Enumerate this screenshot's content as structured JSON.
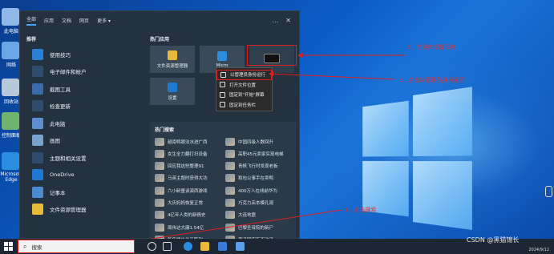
{
  "desktop": {
    "icons": [
      {
        "label": "此电脑",
        "icon": "computer-icon",
        "color": "#8fb8e8"
      },
      {
        "label": "网络",
        "icon": "network-icon",
        "color": "#6aa6e6"
      },
      {
        "label": "回收站",
        "icon": "recycle-bin-icon",
        "color": "#b6c8da"
      },
      {
        "label": "控制面板",
        "icon": "control-panel-icon",
        "color": "#6fb36f"
      },
      {
        "label": "Microsoft Edge",
        "icon": "edge-icon",
        "color": "#2a8de0"
      }
    ]
  },
  "start_menu": {
    "tabs": [
      "全部",
      "应用",
      "文档",
      "网页",
      "更多 ▾"
    ],
    "top_icons": [
      "…",
      "✕"
    ],
    "recommended_title": "推荐",
    "recommended": [
      {
        "label": "使用技巧",
        "icon": "tips-icon",
        "color": "#2a7fd6"
      },
      {
        "label": "电子邮件和帐户",
        "icon": "mail-icon",
        "color": "#2e4d6e"
      },
      {
        "label": "截图工具",
        "icon": "scissors-icon",
        "color": "#3b6aa8"
      },
      {
        "label": "检查更新",
        "icon": "refresh-icon",
        "color": "#2e4d6e"
      },
      {
        "label": "此电脑",
        "icon": "computer-icon",
        "color": "#5d8fd0"
      },
      {
        "label": "画图",
        "icon": "paint-icon",
        "color": "#7aa2cc"
      },
      {
        "label": "主题和相关设置",
        "icon": "brush-icon",
        "color": "#2e4d6e"
      },
      {
        "label": "OneDrive",
        "icon": "cloud-icon",
        "color": "#1f78d1"
      },
      {
        "label": "记事本",
        "icon": "notepad-icon",
        "color": "#4a8ad0"
      },
      {
        "label": "文件资源管理器",
        "icon": "folder-icon",
        "color": "#e8b93a"
      }
    ],
    "hot_apps_title": "热门应用",
    "hot_apps": [
      {
        "label": "文件资源管理器",
        "icon": "folder-icon",
        "color": "#e8b93a"
      },
      {
        "label": "Micro",
        "icon": "edge-icon",
        "color": "#2a8de0"
      },
      {
        "label": "",
        "icon": "terminal-icon",
        "color": "#111111"
      },
      {
        "label": "设置",
        "icon": "gear-icon",
        "color": "#1f78d1"
      }
    ],
    "hot_search_title": "热门搜索",
    "hot_search": [
      "越南鸭眼法水进广西",
      "中国四级人数回升",
      "女生全力翻打扫设备",
      "高职45元卖家实现电梯",
      "回应我这些整理91",
      "青帆飞行时发现老板",
      "马英主题时获得大功",
      "和包公事手在卖鸭",
      "六小龄童谈演西游戏",
      "400万人在线前华为",
      "大庆妈妈恢复正常",
      "巧克力店本模孔观",
      "4亿年人类的新情史",
      "大连地震",
      "周伟达大庸1.54亿",
      "巴黎圣母院的新尸",
      "新年终价当天跃利",
      "孪子回应有不动了"
    ]
  },
  "context_menu": {
    "items": [
      {
        "label": "以管理员身份运行",
        "icon": "shield-icon",
        "highlighted": true
      },
      {
        "label": "打开文件位置",
        "icon": "folder-open-icon",
        "highlighted": false
      },
      {
        "label": "固定到\"开始\"屏幕",
        "icon": "pin-icon",
        "highlighted": false
      },
      {
        "label": "固定到任务栏",
        "icon": "pin-taskbar-icon",
        "highlighted": false
      }
    ]
  },
  "annotations": [
    {
      "text": "2、右键命令提示符",
      "color": "#e02020"
    },
    {
      "text": "3、点击以管理员身份运行",
      "color": "#e02020"
    },
    {
      "text": "1、点击搜索",
      "color": "#e02020"
    }
  ],
  "taskbar": {
    "search_placeholder": "搜索",
    "time": "",
    "date": "2024/9/12",
    "watermark": "CSDN @黑猫锦长"
  }
}
